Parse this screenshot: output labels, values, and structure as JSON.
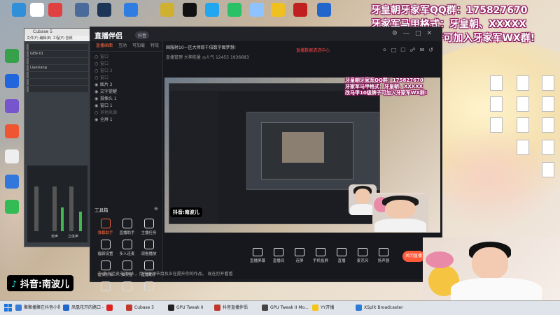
{
  "desktop": {
    "top_icons": [
      {
        "name": "",
        "color": "#2f8fd8"
      },
      {
        "name": "",
        "color": "#ffffff"
      },
      {
        "name": "",
        "color": "#e04040"
      },
      {
        "name": "",
        "color": "#4a6b9a"
      },
      {
        "name": "",
        "color": "#1d3557"
      },
      {
        "name": "",
        "color": "#2f7de1"
      },
      {
        "name": "",
        "color": "#d0b030"
      },
      {
        "name": "",
        "color": "#111111"
      },
      {
        "name": "",
        "color": "#22a6f0"
      },
      {
        "name": "",
        "color": "#2ac066"
      },
      {
        "name": "",
        "color": "#8ec3ff"
      },
      {
        "name": "",
        "color": "#f0c020"
      },
      {
        "name": "",
        "color": "#c02020"
      },
      {
        "name": "",
        "color": "#2266cc"
      }
    ],
    "left_icons": [
      {
        "name": "",
        "color": "#36a04a"
      },
      {
        "name": "",
        "color": "#2266dd"
      },
      {
        "name": "",
        "color": "#7755cc"
      },
      {
        "name": "",
        "color": "#ee5533"
      },
      {
        "name": "",
        "color": "#eeeeee"
      },
      {
        "name": "",
        "color": "#3377dd"
      },
      {
        "name": "",
        "color": "#33bb55"
      }
    ]
  },
  "overlay": {
    "line1": "牙皇朝牙家军QQ群：175827670",
    "line2": "牙家军马甲格式：牙皇朝、XXXXX",
    "line3": "改马甲10级牌子可加入牙家军WX群!"
  },
  "cubase": {
    "title": "Cubase 5",
    "menu": "文件(F)  编辑(E)  工程(P)  音频",
    "tracks": [
      "",
      "GEN-01",
      "",
      "Liaoxiang",
      "",
      "",
      ""
    ],
    "bottom_label_1": "单声",
    "bottom_label_2": "立体声"
  },
  "app": {
    "logo_text": "直播伴侣",
    "badge": "抖音",
    "left_tabs": [
      "直播画面",
      "互动",
      "可加载",
      "特效"
    ],
    "sources": [
      {
        "label": "窗口",
        "visible": false
      },
      {
        "label": "窗口",
        "visible": false
      },
      {
        "label": "窗口 2",
        "visible": false
      },
      {
        "label": "窗口",
        "visible": false
      },
      {
        "label": "图片 2",
        "visible": true
      },
      {
        "label": "文字提醒",
        "visible": true
      },
      {
        "label": "摄像头 1",
        "visible": true
      },
      {
        "label": "窗口 1",
        "visible": true
      },
      {
        "label": "其他来源",
        "visible": false
      },
      {
        "label": "全屏 1",
        "visible": true
      }
    ],
    "tools_title": "工具箱",
    "tools": [
      {
        "label": "弹幕助手",
        "hot": true
      },
      {
        "label": "直播助手",
        "hot": false
      },
      {
        "label": "主播任务",
        "hot": false
      },
      {
        "label": "福袋设置",
        "hot": false
      },
      {
        "label": "多人连麦",
        "hot": false
      },
      {
        "label": "观看播放",
        "hot": false
      },
      {
        "label": "虚拟形象",
        "hot": false
      },
      {
        "label": "抽奖器",
        "hot": false
      },
      {
        "label": "直播助手",
        "hot": false
      },
      {
        "label": "",
        "hot": false
      },
      {
        "label": "",
        "hot": false
      },
      {
        "label": "",
        "hot": false
      }
    ],
    "live_title": "国服射10一区大师耶千倍数字图梦想!",
    "live_row2": "直播管理  大神能量  ◎人气 12455  1936683",
    "live_link": "直播数据请进中心",
    "controls": [
      {
        "label": "直播屏幕"
      },
      {
        "label": "直播间"
      },
      {
        "label": "连屏"
      },
      {
        "label": "手机投屏"
      },
      {
        "label": "直播"
      },
      {
        "label": "麦克风"
      },
      {
        "label": "扬声器"
      }
    ],
    "go_button": "关闭直播",
    "status_text": "多人连麦支持8人，用于展示节目及正在提升你的作品。  现在打开看看"
  },
  "preview": {
    "overlay_l1": "牙皇朝牙家军QQ群：175827670",
    "overlay_l2": "牙家军马甲格式：牙皇朝、XXXXX",
    "overlay_l3": "改马甲10级牌子可加入牙家军WX群!",
    "watermark": "抖音:南波儿"
  },
  "watermark_main": "抖音:南波儿",
  "taskbar": {
    "items": [
      {
        "label": "聚聚播聚在抖音小视",
        "color": "#3a7bd5"
      },
      {
        "label": "凤凰花开的路口 -",
        "color": "#2266cc"
      },
      {
        "label": "",
        "color": "#dd2222"
      },
      {
        "label": "Cubase 5",
        "color": "#c0392b"
      },
      {
        "label": "GPU Tweak II",
        "color": "#222222"
      },
      {
        "label": "抖音直播伴侣",
        "color": "#c0392b"
      },
      {
        "label": "GPU Tweak II Mo...",
        "color": "#444444"
      },
      {
        "label": "YY开播",
        "color": "#f5c518"
      },
      {
        "label": "XSplit Broadcaster",
        "color": "#2b7bd8"
      }
    ],
    "clock": ""
  }
}
